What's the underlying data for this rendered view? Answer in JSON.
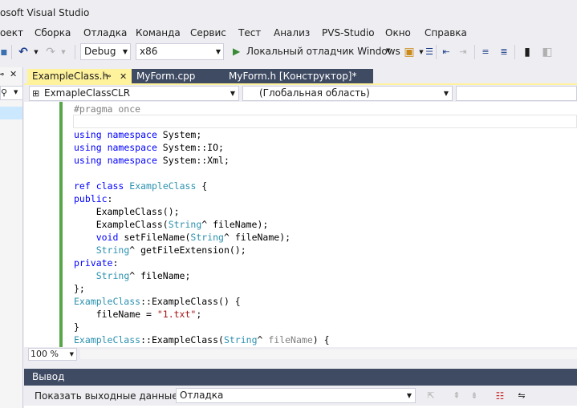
{
  "window": {
    "title": "osoft Visual Studio"
  },
  "menu": [
    "оект",
    "Сборка",
    "Отладка",
    "Команда",
    "Сервис",
    "Тест",
    "Анализ",
    "PVS-Studio",
    "Окно",
    "Справка"
  ],
  "toolbar": {
    "config": "Debug",
    "platform": "x86",
    "run_label": "Локальный отладчик Windows"
  },
  "tabs": [
    {
      "label": "ExampleClass.h",
      "pin": "⊸",
      "close": "✕"
    },
    {
      "label": "MyForm.cpp"
    },
    {
      "label": "MyForm.h [Конструктор]*"
    }
  ],
  "nav": {
    "project": "ExmapleClassCLR",
    "scope": "(Глобальная область)"
  },
  "code": [
    [
      {
        "t": "#pragma once",
        "c": "pp"
      }
    ],
    [],
    [
      {
        "t": "using",
        "c": "kw"
      },
      {
        "t": " "
      },
      {
        "t": "namespace",
        "c": "kw"
      },
      {
        "t": " System;"
      }
    ],
    [
      {
        "t": "using",
        "c": "kw"
      },
      {
        "t": " "
      },
      {
        "t": "namespace",
        "c": "kw"
      },
      {
        "t": " System::IO;"
      }
    ],
    [
      {
        "t": "using",
        "c": "kw"
      },
      {
        "t": " "
      },
      {
        "t": "namespace",
        "c": "kw"
      },
      {
        "t": " System::Xml;"
      }
    ],
    [],
    [
      {
        "t": "ref",
        "c": "kw"
      },
      {
        "t": " "
      },
      {
        "t": "class",
        "c": "kw"
      },
      {
        "t": " "
      },
      {
        "t": "ExampleClass",
        "c": "ty"
      },
      {
        "t": " {"
      }
    ],
    [
      {
        "t": "public",
        "c": "kw"
      },
      {
        "t": ":"
      }
    ],
    [
      {
        "t": "    ExampleClass();"
      }
    ],
    [
      {
        "t": "    ExampleClass("
      },
      {
        "t": "String",
        "c": "ty"
      },
      {
        "t": "^ fileName);"
      }
    ],
    [
      {
        "t": "    "
      },
      {
        "t": "void",
        "c": "kw"
      },
      {
        "t": " setFileName("
      },
      {
        "t": "String",
        "c": "ty"
      },
      {
        "t": "^ fileName);"
      }
    ],
    [
      {
        "t": "    "
      },
      {
        "t": "String",
        "c": "ty"
      },
      {
        "t": "^ getFileExtension();"
      }
    ],
    [
      {
        "t": "private",
        "c": "kw"
      },
      {
        "t": ":"
      }
    ],
    [
      {
        "t": "    "
      },
      {
        "t": "String",
        "c": "ty"
      },
      {
        "t": "^ fileName;"
      }
    ],
    [
      {
        "t": "};"
      }
    ],
    [
      {
        "t": "ExampleClass",
        "c": "ty"
      },
      {
        "t": "::ExampleClass() {"
      }
    ],
    [
      {
        "t": "    fileName = "
      },
      {
        "t": "\"1.txt\"",
        "c": "st"
      },
      {
        "t": ";"
      }
    ],
    [
      {
        "t": "}"
      }
    ],
    [
      {
        "t": "ExampleClass",
        "c": "ty"
      },
      {
        "t": "::ExampleClass("
      },
      {
        "t": "String",
        "c": "ty"
      },
      {
        "t": "^ "
      },
      {
        "t": "fileName",
        "c": "grey"
      },
      {
        "t": ") {"
      }
    ]
  ],
  "zoom": "100 %",
  "output": {
    "title": "Вывод",
    "show_label": "Показать выходные данные из:",
    "source": "Отладка"
  },
  "colors": {
    "active_tab": "#fff29d",
    "inactive_tab": "#3f4b63",
    "keyword": "#0000ff",
    "type": "#2b91af",
    "string": "#a31515",
    "change_bar": "#57a64a"
  }
}
